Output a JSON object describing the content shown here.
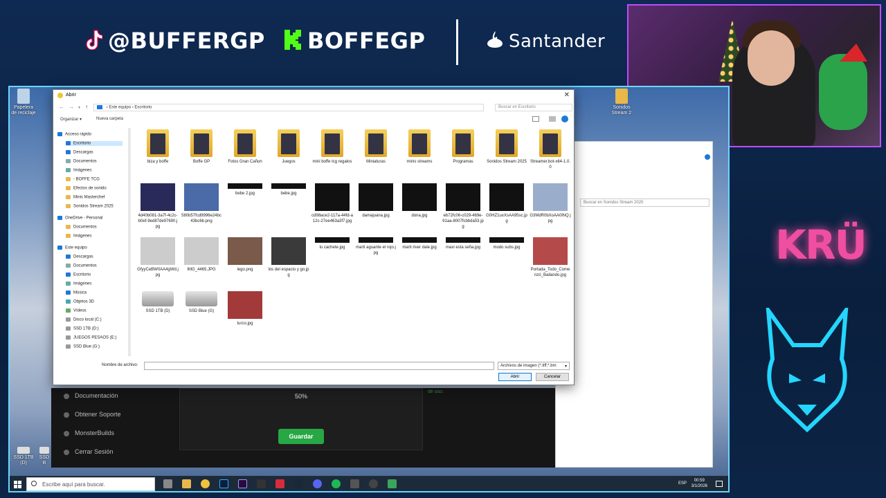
{
  "overlay": {
    "tiktok_handle": "@BUFFERGP",
    "kick_handle": "BOFFEGP",
    "sponsor": "Santander",
    "team_logo": "KRÜ",
    "colors": {
      "tiktok": "#ff0050",
      "kick": "#53fc18",
      "kru": "#f04ea0",
      "wolf": "#24d6ff"
    }
  },
  "desktop": {
    "icons": [
      {
        "label": "Papelera de reciclaje"
      },
      {
        "label": "Sonidos Stream 2"
      },
      {
        "label": "SSD 1TB (D)"
      },
      {
        "label": "SSD B"
      }
    ]
  },
  "background_app": {
    "menu": [
      "Documentación",
      "Obtener Soporte",
      "MonsterBuilds",
      "Cerrar Sesión"
    ],
    "progress_label": "50%",
    "save_label": "Guardar",
    "fragment": "de uso.",
    "right_window_search": "Buscar en Sonidos Stream 2025"
  },
  "dialog": {
    "title": "Abrir",
    "breadcrumb": [
      "Este equipo",
      "Escritorio"
    ],
    "search_placeholder": "Buscar en Escritorio",
    "organize_label": "Organizar ▾",
    "new_folder_label": "Nueva carpeta",
    "sidebar": [
      {
        "label": "Acceso rápido",
        "level": 0,
        "icon": "star-icon"
      },
      {
        "label": "Escritorio",
        "level": 1,
        "icon": "desktop-icon",
        "selected": true
      },
      {
        "label": "Descargas",
        "level": 1,
        "icon": "download-icon"
      },
      {
        "label": "Documentos",
        "level": 1,
        "icon": "document-icon"
      },
      {
        "label": "Imágenes",
        "level": 1,
        "icon": "image-icon"
      },
      {
        "label": "- BOFFE TCG",
        "level": 1,
        "icon": "folder-icon"
      },
      {
        "label": "Efectos de sonido",
        "level": 1,
        "icon": "folder-icon"
      },
      {
        "label": "Minis Masterchef",
        "level": 1,
        "icon": "folder-icon"
      },
      {
        "label": "Sonidos Stream 2025",
        "level": 1,
        "icon": "folder-icon"
      },
      {
        "label": "OneDrive - Personal",
        "level": 0,
        "icon": "cloud-icon"
      },
      {
        "label": "Documentos",
        "level": 1,
        "icon": "folder-icon"
      },
      {
        "label": "Imágenes",
        "level": 1,
        "icon": "folder-icon"
      },
      {
        "label": "Este equipo",
        "level": 0,
        "icon": "computer-icon"
      },
      {
        "label": "Descargas",
        "level": 1,
        "icon": "download-icon"
      },
      {
        "label": "Documentos",
        "level": 1,
        "icon": "document-icon"
      },
      {
        "label": "Escritorio",
        "level": 1,
        "icon": "desktop-icon"
      },
      {
        "label": "Imágenes",
        "level": 1,
        "icon": "image-icon"
      },
      {
        "label": "Música",
        "level": 1,
        "icon": "music-icon"
      },
      {
        "label": "Objetos 3D",
        "level": 1,
        "icon": "cube-icon"
      },
      {
        "label": "Vídeos",
        "level": 1,
        "icon": "video-icon"
      },
      {
        "label": "Disco local (C:)",
        "level": 1,
        "icon": "drive-icon"
      },
      {
        "label": "SSD 1TB (D:)",
        "level": 1,
        "icon": "drive-icon"
      },
      {
        "label": "JUEGOS PESAOS (E:)",
        "level": 1,
        "icon": "drive-icon"
      },
      {
        "label": "SSD Blue (G:)",
        "level": 1,
        "icon": "drive-icon"
      }
    ],
    "files": [
      {
        "label": "biza y boffe",
        "kind": "folder"
      },
      {
        "label": "Boffe GP",
        "kind": "folder"
      },
      {
        "label": "Fotos Gran Cañon",
        "kind": "folder"
      },
      {
        "label": "Juegos",
        "kind": "folder"
      },
      {
        "label": "mini boffe tcg regalos",
        "kind": "folder"
      },
      {
        "label": "Miniaturas",
        "kind": "folder"
      },
      {
        "label": "minis streams",
        "kind": "folder"
      },
      {
        "label": "Programas",
        "kind": "folder"
      },
      {
        "label": "Sonidos Stream 2025",
        "kind": "folder"
      },
      {
        "label": "Streamer.bot-x64-1.0.0",
        "kind": "folder"
      },
      {
        "label": "4d40b081-3a7f-4c2c-b0ef-9ed87de97690.jpg",
        "kind": "photo"
      },
      {
        "label": "580b57fcd9996e24bc43bc6b.png",
        "kind": "photo"
      },
      {
        "label": "bebe 2.jpg",
        "kind": "strip"
      },
      {
        "label": "bebe.jpg",
        "kind": "strip"
      },
      {
        "label": "cd98ace2-117a-44fd-a12c-27ee463a3f7.jpg",
        "kind": "photo"
      },
      {
        "label": "damajuana.jpg",
        "kind": "photo"
      },
      {
        "label": "dona.jpg",
        "kind": "photo"
      },
      {
        "label": "eb72fc06-c029-469e-91aa-8007fcbbda53.jpg",
        "kind": "photo"
      },
      {
        "label": "G0HZ1uxXsAA95sc.jpg",
        "kind": "photo"
      },
      {
        "label": "G3MdR0bXoAA0lNQ.jpg",
        "kind": "photo"
      },
      {
        "label": "GfyyCeBW0AA4gWd.jpg",
        "kind": "photo"
      },
      {
        "label": "IMG_4465.JPG",
        "kind": "photo"
      },
      {
        "label": "lego.png",
        "kind": "photo"
      },
      {
        "label": "los del espacio y go.jpg",
        "kind": "photo"
      },
      {
        "label": "lu cachete.jpg",
        "kind": "strip"
      },
      {
        "label": "marti aguante el rojo.jpg",
        "kind": "strip"
      },
      {
        "label": "marti river dale.jpg",
        "kind": "strip"
      },
      {
        "label": "maxi esta seña.jpg",
        "kind": "strip"
      },
      {
        "label": "modo subs.jpg",
        "kind": "strip"
      },
      {
        "label": "Portada_Todo_Comenzó_Bailando.jpg",
        "kind": "photo"
      },
      {
        "label": "SSD 1TB (D)",
        "kind": "drive"
      },
      {
        "label": "SSD Blue (G)",
        "kind": "drive"
      },
      {
        "label": "turco.jpg",
        "kind": "photo"
      }
    ],
    "filename_label": "Nombre de archivo:",
    "filename_value": "",
    "filter_label": "Archivos de imagen (*.tiff;*.bm",
    "open_label": "Abrir",
    "cancel_label": "Cancelar"
  },
  "taskbar": {
    "search_placeholder": "Escribe aquí para buscar.",
    "language": "ESP",
    "time": "00:59",
    "date": "3/1/2026"
  }
}
